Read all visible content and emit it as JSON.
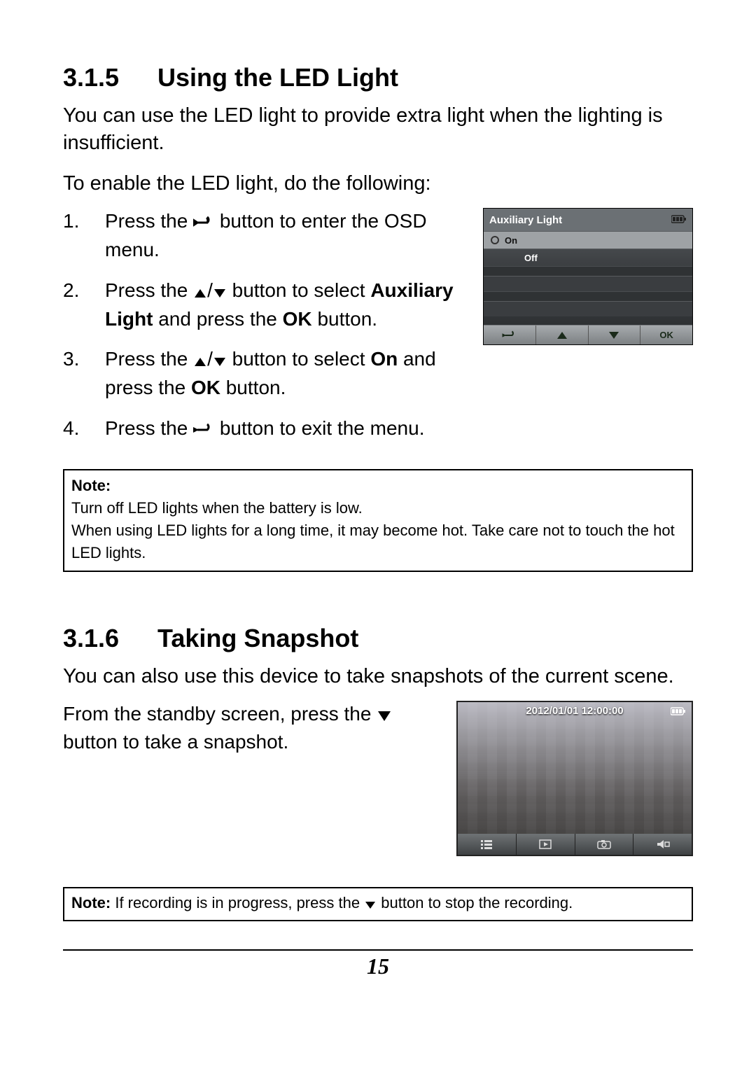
{
  "section1": {
    "number": "3.1.5",
    "title": "Using the LED Light",
    "intro": "You can use the LED light to provide extra light when the lighting is insufficient.",
    "lead": "To enable the LED light, do the following:",
    "steps": {
      "s1a": "Press the ",
      "s1b": " button to enter the OSD menu.",
      "s2a": "Press the ",
      "s2b": " button to select ",
      "s2bold": "Auxiliary Light",
      "s2c": " and press the ",
      "s2ok": "OK",
      "s2d": " button.",
      "s3a": "Press the ",
      "s3b": " button to select ",
      "s3bold": "On",
      "s3c": " and press the ",
      "s3ok": "OK",
      "s3d": " button.",
      "s4a": "Press the ",
      "s4b": " button to exit the menu."
    },
    "note_label": "Note:",
    "note_line1": "Turn off LED lights when the battery is low.",
    "note_line2": "When using LED lights for a long time, it may become hot. Take care not to touch the hot LED lights."
  },
  "aux_screen": {
    "title": "Auxiliary Light",
    "option_on": "On",
    "option_off": "Off",
    "ok_label": "OK"
  },
  "section2": {
    "number": "3.1.6",
    "title": "Taking Snapshot",
    "intro": "You can also use this device to take snapshots of the current scene.",
    "body_a": "From the standby screen, press the ",
    "body_b": " button to take a snapshot."
  },
  "snap_screen": {
    "timestamp": "2012/01/01  12:00:00"
  },
  "note2_label": "Note:",
  "note2_a": " If recording is in progress, press the ",
  "note2_b": " button to stop the recording.",
  "page_number": "15"
}
